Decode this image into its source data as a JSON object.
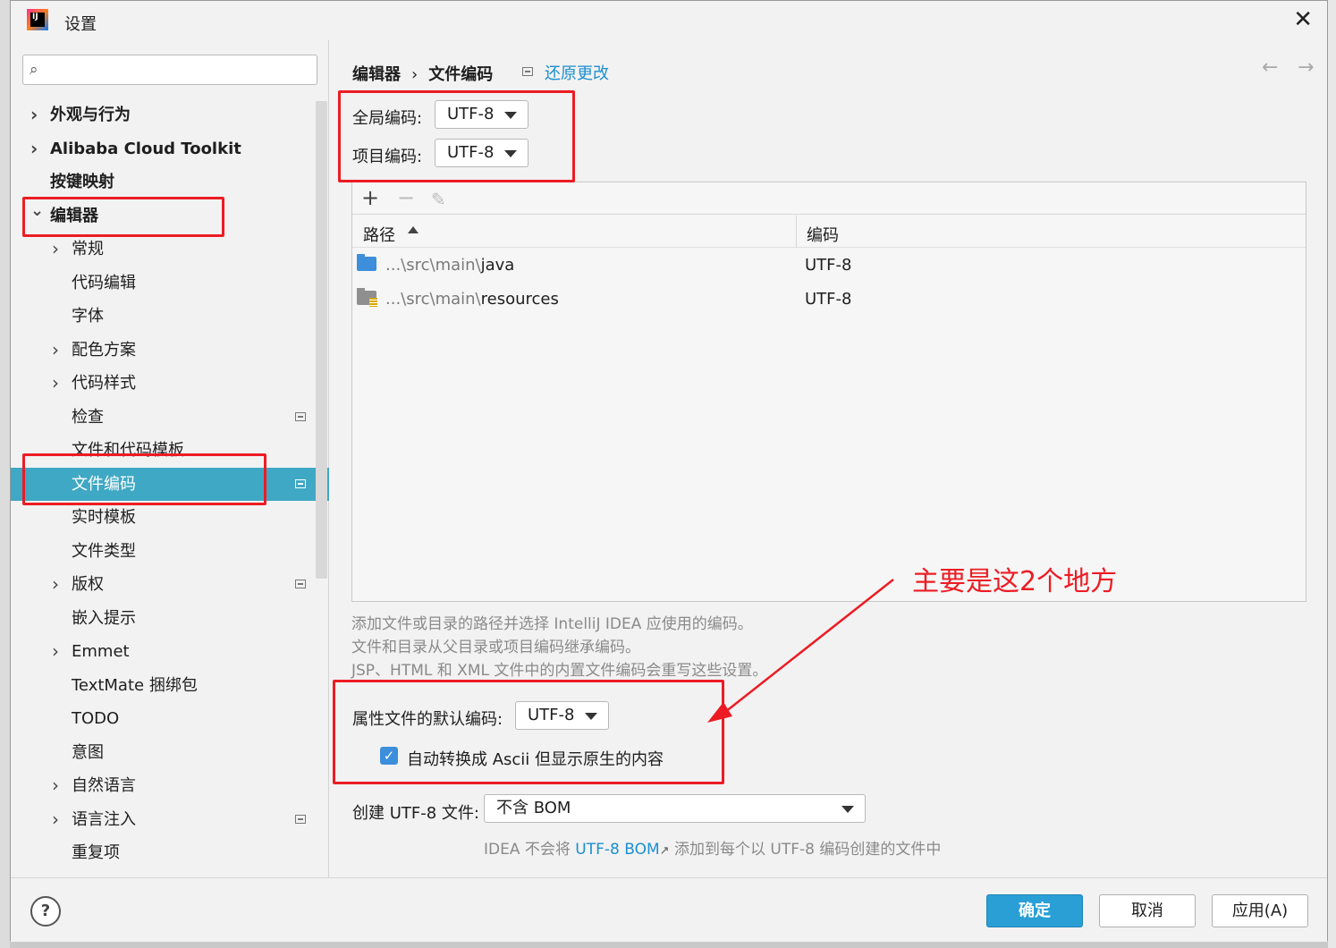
{
  "window": {
    "title": "设置"
  },
  "search": {
    "placeholder": ""
  },
  "sidebar": {
    "items": [
      {
        "label": "外观与行为",
        "level": 0,
        "chevron": "right"
      },
      {
        "label": "Alibaba Cloud Toolkit",
        "level": 0,
        "chevron": "right"
      },
      {
        "label": "按键映射",
        "level": 0,
        "chevron": ""
      },
      {
        "label": "编辑器",
        "level": 0,
        "chevron": "down"
      },
      {
        "label": "常规",
        "level": 1,
        "chevron": "right"
      },
      {
        "label": "代码编辑",
        "level": 1,
        "chevron": ""
      },
      {
        "label": "字体",
        "level": 1,
        "chevron": ""
      },
      {
        "label": "配色方案",
        "level": 1,
        "chevron": "right"
      },
      {
        "label": "代码样式",
        "level": 1,
        "chevron": "right"
      },
      {
        "label": "检查",
        "level": 1,
        "chevron": "",
        "project_icon": true
      },
      {
        "label": "文件和代码模板",
        "level": 1,
        "chevron": ""
      },
      {
        "label": "文件编码",
        "level": 1,
        "chevron": "",
        "project_icon": true,
        "selected": true
      },
      {
        "label": "实时模板",
        "level": 1,
        "chevron": ""
      },
      {
        "label": "文件类型",
        "level": 1,
        "chevron": ""
      },
      {
        "label": "版权",
        "level": 1,
        "chevron": "right",
        "project_icon": true
      },
      {
        "label": "嵌入提示",
        "level": 1,
        "chevron": ""
      },
      {
        "label": "Emmet",
        "level": 1,
        "chevron": "right"
      },
      {
        "label": "TextMate 捆绑包",
        "level": 1,
        "chevron": ""
      },
      {
        "label": "TODO",
        "level": 1,
        "chevron": ""
      },
      {
        "label": "意图",
        "level": 1,
        "chevron": ""
      },
      {
        "label": "自然语言",
        "level": 1,
        "chevron": "right"
      },
      {
        "label": "语言注入",
        "level": 1,
        "chevron": "right",
        "project_icon": true
      },
      {
        "label": "重复项",
        "level": 1,
        "chevron": ""
      }
    ]
  },
  "breadcrumb": {
    "parent": "编辑器",
    "separator": "›",
    "current": "文件编码"
  },
  "reset_link": "还原更改",
  "nav": {
    "back": "←",
    "forward": "→"
  },
  "encoding": {
    "global_label": "全局编码:",
    "global_value": "UTF-8",
    "project_label": "项目编码:",
    "project_value": "UTF-8"
  },
  "table": {
    "toolbar": {
      "add": "+",
      "remove": "−",
      "edit": "✎"
    },
    "columns": {
      "path": "路径",
      "encoding": "编码"
    },
    "rows": [
      {
        "prefix": "...\\src\\main\\",
        "name": "java",
        "encoding": "UTF-8",
        "icon": "folder-icon"
      },
      {
        "prefix": "...\\src\\main\\",
        "name": "resources",
        "encoding": "UTF-8",
        "icon": "resources-folder-icon"
      }
    ]
  },
  "hints": [
    "添加文件或目录的路径并选择 IntelliJ IDEA 应使用的编码。",
    "文件和目录从父目录或项目编码继承编码。",
    "JSP、HTML 和 XML 文件中的内置文件编码会重写这些设置。"
  ],
  "properties": {
    "label": "属性文件的默认编码:",
    "value": "UTF-8",
    "checkbox_label": "自动转换成 Ascii 但显示原生的内容",
    "checked": true
  },
  "bom": {
    "label": "创建 UTF-8 文件:",
    "value": "不含 BOM",
    "note_prefix": "IDEA 不会将",
    "note_link": "UTF-8 BOM",
    "note_link_arrow": "↗",
    "note_suffix": "添加到每个以 UTF-8 编码创建的文件中"
  },
  "annotation": {
    "text": "主要是这2个地方",
    "color": "#ec1c24"
  },
  "buttons": {
    "ok": "确定",
    "cancel": "取消",
    "apply": "应用(A)",
    "help": "?"
  },
  "colors": {
    "selection": "#3fa8c4",
    "link": "#1b8fd0",
    "primary_button": "#2a9fd6",
    "highlight_box": "#ec1c24"
  }
}
